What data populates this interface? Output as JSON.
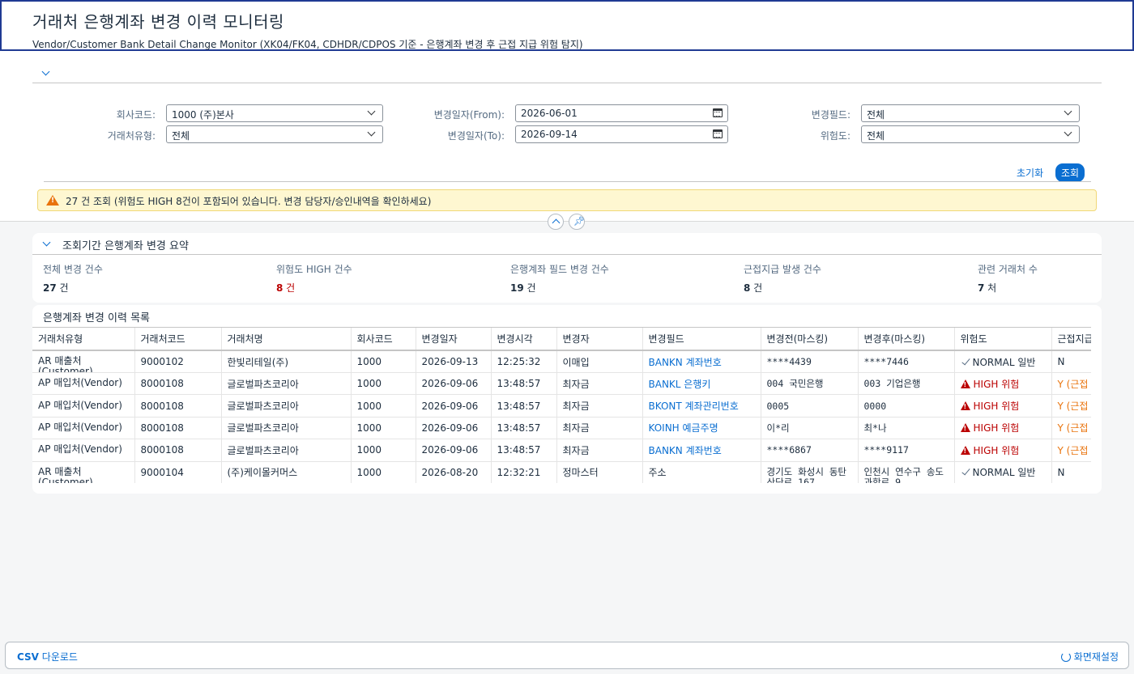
{
  "header": {
    "title": "거래처 은행계좌 변경 이력 모니터링",
    "subtitle": "Vendor/Customer Bank Detail Change Monitor (XK04/FK04, CDHDR/CDPOS 기준 - 은행계좌 변경 후 근접 지급 위험 탐지)"
  },
  "filters": {
    "company_code": {
      "label": "회사코드:",
      "value": "1000 (주)본사"
    },
    "partner_type": {
      "label": "거래처유형:",
      "value": "전체"
    },
    "date_from": {
      "label": "변경일자(From):",
      "value": "2026-06-01"
    },
    "date_to": {
      "label": "변경일자(To):",
      "value": "2026-09-14"
    },
    "change_field": {
      "label": "변경필드:",
      "value": "전체"
    },
    "risk": {
      "label": "위험도:",
      "value": "전체"
    },
    "reset_label": "초기화",
    "search_label": "조회"
  },
  "message": "27 건 조회 (위험도 HIGH 8건이 포함되어 있습니다. 변경 담당자/승인내역을 확인하세요)",
  "summary": {
    "title": "조회기간 은행계좌 변경 요약",
    "kpis": [
      {
        "label": "전체 변경 건수",
        "value": "27",
        "unit": " 건"
      },
      {
        "label": "위험도 HIGH 건수",
        "value": "8",
        "unit": " 건"
      },
      {
        "label": "은행계좌 필드 변경 건수",
        "value": "19",
        "unit": " 건"
      },
      {
        "label": "근접지급 발생 건수",
        "value": "8",
        "unit": " 건"
      },
      {
        "label": "관련 거래처 수",
        "value": "7",
        "unit": " 처"
      }
    ]
  },
  "table": {
    "title": "은행계좌 변경 이력 목록",
    "columns": [
      "거래처유형",
      "거래처코드",
      "거래처명",
      "회사코드",
      "변경일자",
      "변경시각",
      "변경자",
      "변경필드",
      "변경전(마스킹)",
      "변경후(마스킹)",
      "위험도",
      "근접지급"
    ],
    "rows": [
      [
        "AR 매출처(Customer)",
        "9000102",
        "한빛리테일(주)",
        "1000",
        "2026-09-13",
        "12:25:32",
        "이매입",
        "BANKN 계좌번호",
        "****4439",
        "****7446",
        "NORMAL 일반",
        "N"
      ],
      [
        "AP 매입처(Vendor)",
        "8000108",
        "글로벌파츠코리아",
        "1000",
        "2026-09-06",
        "13:48:57",
        "최자금",
        "BANKL 은행키",
        "004 국민은행",
        "003 기업은행",
        "HIGH 위험",
        "Y (근접"
      ],
      [
        "AP 매입처(Vendor)",
        "8000108",
        "글로벌파츠코리아",
        "1000",
        "2026-09-06",
        "13:48:57",
        "최자금",
        "BKONT 계좌관리번호",
        "0005",
        "0000",
        "HIGH 위험",
        "Y (근접"
      ],
      [
        "AP 매입처(Vendor)",
        "8000108",
        "글로벌파츠코리아",
        "1000",
        "2026-09-06",
        "13:48:57",
        "최자금",
        "KOINH 예금주명",
        "이*리",
        "최*나",
        "HIGH 위험",
        "Y (근접"
      ],
      [
        "AP 매입처(Vendor)",
        "8000108",
        "글로벌파츠코리아",
        "1000",
        "2026-09-06",
        "13:48:57",
        "최자금",
        "BANKN 계좌번호",
        "****6867",
        "****9117",
        "HIGH 위험",
        "Y (근접"
      ],
      [
        "AR 매출처(Customer)",
        "9000104",
        "(주)케이몰커머스",
        "1000",
        "2026-08-20",
        "12:32:21",
        "정마스터",
        "주소",
        "경기도 화성시 동탄산단로 167",
        "인천시 연수구 송도과학로 9",
        "NORMAL 일반",
        "N"
      ]
    ]
  },
  "footer": {
    "csv_bold": "CSV",
    "csv_rest": " 다운로드",
    "reset_layout": "화면재설정"
  },
  "colors": {
    "accent": "#0a6ed1",
    "high": "#bb0000",
    "warning": "#e9730c"
  }
}
